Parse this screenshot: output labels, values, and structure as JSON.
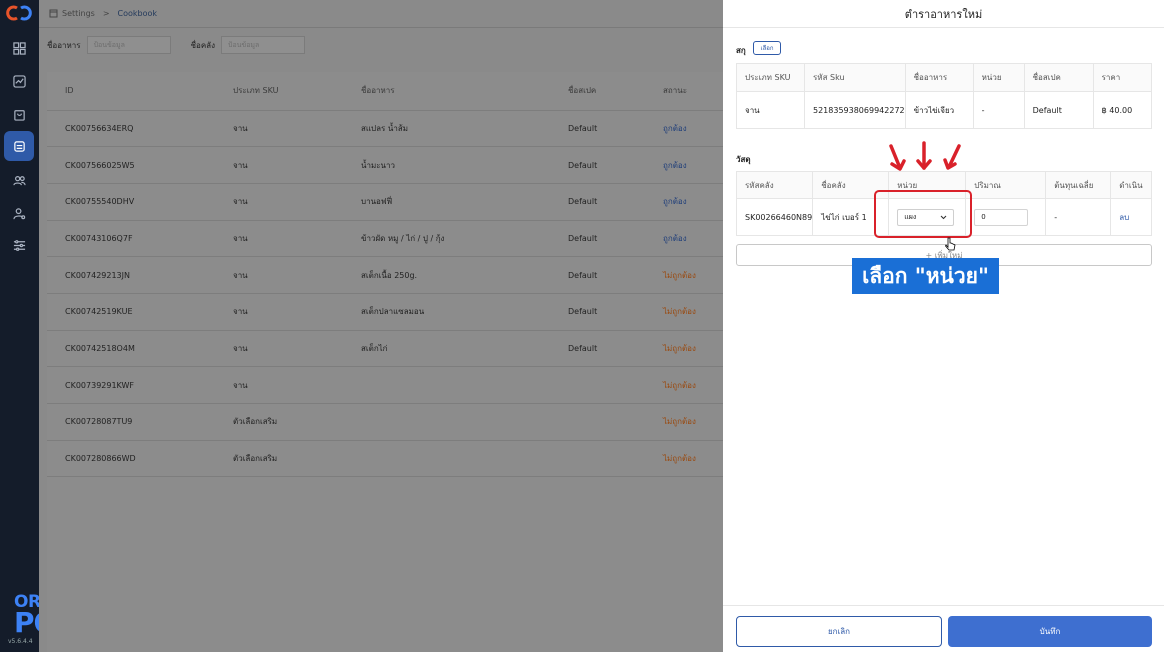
{
  "colors": {
    "sidebar_bg": "#141c2a",
    "accent": "#2f5aa8",
    "ok_status": "#1f3e7a",
    "bad_status": "#9a4a10",
    "highlight": "#d9212a",
    "callout_bg": "#1a6fd6"
  },
  "brand": {
    "line1": "ORDER",
    "line2": "POS",
    "version": "v5.6.4.4"
  },
  "breadcrumb": {
    "settings": "Settings",
    "separator": ">",
    "current": "Cookbook"
  },
  "filters": {
    "food_name_label": "ชื่ออาหาร",
    "food_name_placeholder": "ป้อนข้อมูล",
    "warehouse_label": "ชื่อคลัง",
    "warehouse_placeholder": "ป้อนข้อมูล"
  },
  "list_table": {
    "headers": [
      "ID",
      "ประเภท SKU",
      "ชื่ออาหาร",
      "ชื่อสเปค",
      "สถานะ"
    ],
    "rows": [
      {
        "id": "CK00756634ERQ",
        "sku_type": "จาน",
        "name": "สแปลร น้ำส้ม",
        "spec": "Default",
        "status": "ถูกต้อง",
        "ok": true
      },
      {
        "id": "CK007566025W5",
        "sku_type": "จาน",
        "name": "น้ำมะนาว",
        "spec": "Default",
        "status": "ถูกต้อง",
        "ok": true
      },
      {
        "id": "CK00755540DHV",
        "sku_type": "จาน",
        "name": "บานอฟฟี่",
        "spec": "Default",
        "status": "ถูกต้อง",
        "ok": true
      },
      {
        "id": "CK00743106Q7F",
        "sku_type": "จาน",
        "name": "ข้าวผัด หมู / ไก่ / ปู / กุ้ง",
        "spec": "Default",
        "status": "ถูกต้อง",
        "ok": true
      },
      {
        "id": "CK007429213JN",
        "sku_type": "จาน",
        "name": "สเต็กเนื้อ 250g.",
        "spec": "Default",
        "status": "ไม่ถูกต้อง",
        "ok": false
      },
      {
        "id": "CK00742519KUE",
        "sku_type": "จาน",
        "name": "สเต็กปลาแซลมอน",
        "spec": "Default",
        "status": "ไม่ถูกต้อง",
        "ok": false
      },
      {
        "id": "CK00742518O4M",
        "sku_type": "จาน",
        "name": "สเต็กไก่",
        "spec": "Default",
        "status": "ไม่ถูกต้อง",
        "ok": false
      },
      {
        "id": "CK00739291KWF",
        "sku_type": "จาน",
        "name": "",
        "spec": "",
        "status": "ไม่ถูกต้อง",
        "ok": false
      },
      {
        "id": "CK00728087TU9",
        "sku_type": "ตัวเลือกเสริม",
        "name": "",
        "spec": "",
        "status": "ไม่ถูกต้อง",
        "ok": false
      },
      {
        "id": "CK00728086​6WD",
        "sku_type": "ตัวเลือกเสริม",
        "name": "",
        "spec": "",
        "status": "ไม่ถูกต้อง",
        "ok": false
      }
    ]
  },
  "panel": {
    "title": "ตำราอาหารใหม่",
    "sku_section_label": "สกุ",
    "choose_button": "เลือก",
    "sku_table": {
      "headers": [
        "ประเภท SKU",
        "รหัส Sku",
        "ชื่ออาหาร",
        "หน่วย",
        "ชื่อสเปค",
        "ราคา"
      ],
      "row": [
        "จาน",
        "521835938069942272",
        "ข้าวไข่เจียว",
        "-",
        "Default",
        "฿ 40.00"
      ]
    },
    "material_section_label": "วัสดุ",
    "material_table": {
      "headers": [
        "รหัสคลัง",
        "ชื่อคลัง",
        "หน่วย",
        "ปริมาณ",
        "ต้นทุนเฉลี่ย",
        "ดำเนิน"
      ],
      "row": {
        "code": "SK00266460N89",
        "name": "ไข่ไก่ เบอร์ 1",
        "unit": "แผง",
        "qty": "0",
        "avg_cost": "-",
        "action": "ลบ"
      }
    },
    "add_new": "+ เพิ่มใหม่",
    "callout": "เลือก \"หน่วย\"",
    "cancel_button": "ยกเลิก",
    "save_button": "บันทึก"
  }
}
